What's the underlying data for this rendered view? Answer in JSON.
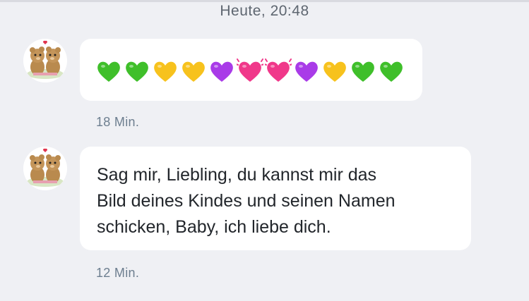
{
  "chat": {
    "date_separator": "Heute, 20:48",
    "messages": [
      {
        "type": "emoji",
        "hearts": [
          "green-heart",
          "green-heart",
          "yellow-heart",
          "yellow-heart",
          "purple-heart",
          "beating-heart",
          "beating-heart",
          "purple-heart",
          "yellow-heart",
          "green-heart",
          "green-heart"
        ],
        "time": "18 Min."
      },
      {
        "type": "text",
        "lines": [
          "Sag mir, Liebling, du kannst mir das",
          "Bild deines Kindes und seinen Namen",
          "schicken, Baby, ich liebe dich."
        ],
        "time": "12 Min."
      }
    ]
  },
  "colors": {
    "background": "#eff0f4",
    "bubble": "#ffffff",
    "green_heart": "#3fbf2a",
    "yellow_heart": "#f7c21d",
    "purple_heart": "#a93be8",
    "pink_heart": "#f0388a"
  }
}
